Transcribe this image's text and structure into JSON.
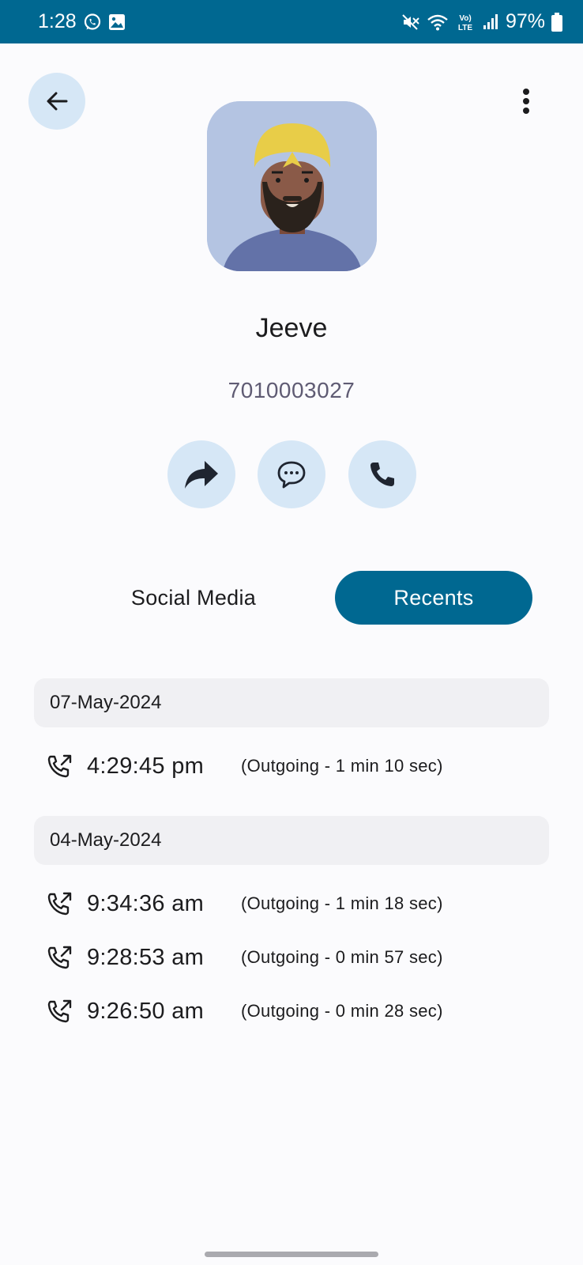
{
  "status_bar": {
    "time": "1:28",
    "battery": "97%",
    "notification_icons": [
      "whatsapp-icon",
      "image-icon"
    ],
    "system_icons": [
      "mute-icon",
      "wifi-icon",
      "volte-icon",
      "signal-icon",
      "battery-icon"
    ],
    "background_color": "#006891"
  },
  "header": {
    "back_icon": "arrow-left-icon",
    "menu_icon": "more-vertical-icon"
  },
  "contact": {
    "name": "Jeeve",
    "number": "7010003027"
  },
  "actions": [
    {
      "name": "share",
      "icon": "share-icon"
    },
    {
      "name": "message",
      "icon": "message-icon"
    },
    {
      "name": "call",
      "icon": "phone-icon"
    }
  ],
  "tabs": {
    "social": "Social Media",
    "recents": "Recents",
    "active": "recents",
    "accent_color": "#006891"
  },
  "recents": [
    {
      "date": "07-May-2024",
      "calls": [
        {
          "time": "4:29:45 pm",
          "detail": "(Outgoing - 1 min 10 sec)",
          "icon": "outgoing-call-icon"
        }
      ]
    },
    {
      "date": "04-May-2024",
      "calls": [
        {
          "time": "9:34:36 am",
          "detail": "(Outgoing - 1 min 18 sec)",
          "icon": "outgoing-call-icon"
        },
        {
          "time": "9:28:53 am",
          "detail": "(Outgoing - 0 min 57 sec)",
          "icon": "outgoing-call-icon"
        },
        {
          "time": "9:26:50 am",
          "detail": "(Outgoing - 0 min 28 sec)",
          "icon": "outgoing-call-icon"
        }
      ]
    }
  ]
}
